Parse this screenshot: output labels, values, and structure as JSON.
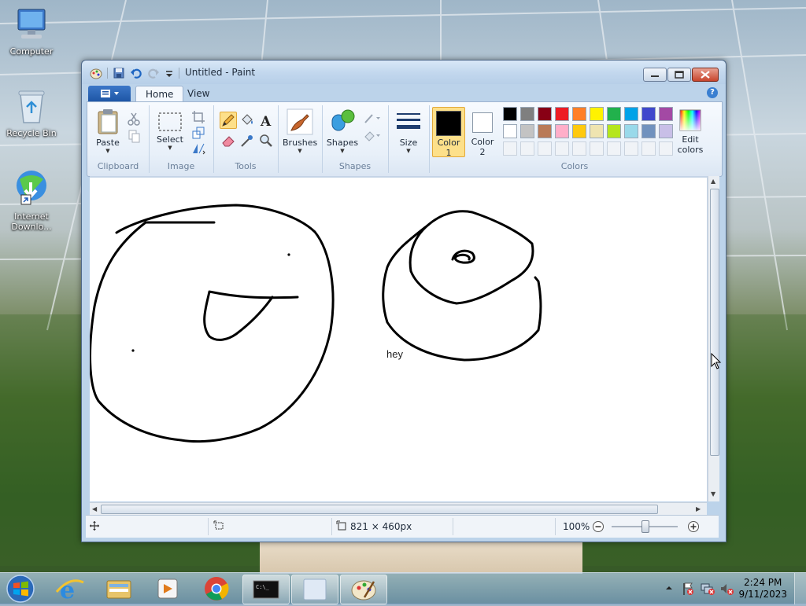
{
  "desktop": {
    "icons": [
      {
        "label": "Computer",
        "icon": "computer-icon"
      },
      {
        "label": "Recycle Bin",
        "icon": "recycle-bin-icon"
      },
      {
        "label": "Internet Downlo...",
        "icon": "internet-download-manager-icon"
      }
    ]
  },
  "window": {
    "title": "Untitled - Paint",
    "tabs": [
      "Home",
      "View"
    ],
    "help": "?"
  },
  "ribbon": {
    "clipboard": {
      "paste": "Paste",
      "group": "Clipboard"
    },
    "image": {
      "select": "Select",
      "group": "Image"
    },
    "tools": {
      "group": "Tools"
    },
    "brushes": {
      "label": "Brushes"
    },
    "shapes": {
      "label": "Shapes",
      "group": "Shapes"
    },
    "size": {
      "label": "Size"
    },
    "colors": {
      "color1": "Color 1",
      "color2": "Color 2",
      "edit": "Edit colors",
      "group": "Colors",
      "color1_value": "#000000",
      "color2_value": "#ffffff",
      "palette_row1": [
        "#000000",
        "#7f7f7f",
        "#880015",
        "#ed1c24",
        "#ff7f27",
        "#fff200",
        "#22b14c",
        "#00a2e8",
        "#3f48cc",
        "#a349a4"
      ],
      "palette_row2": [
        "#ffffff",
        "#c3c3c3",
        "#b97a57",
        "#ffaec9",
        "#ffc90e",
        "#efe4b0",
        "#b5e61d",
        "#99d9ea",
        "#7092be",
        "#c8bfe7"
      ]
    }
  },
  "canvas": {
    "text": "hey"
  },
  "statusbar": {
    "size": "821 × 460px",
    "zoom": "100%"
  },
  "taskbar": {
    "time": "2:24 PM",
    "date": "9/11/2023",
    "apps": [
      "windows-explorer",
      "windows-media-player",
      "chrome",
      "command-prompt",
      "blank-window",
      "paint"
    ]
  }
}
